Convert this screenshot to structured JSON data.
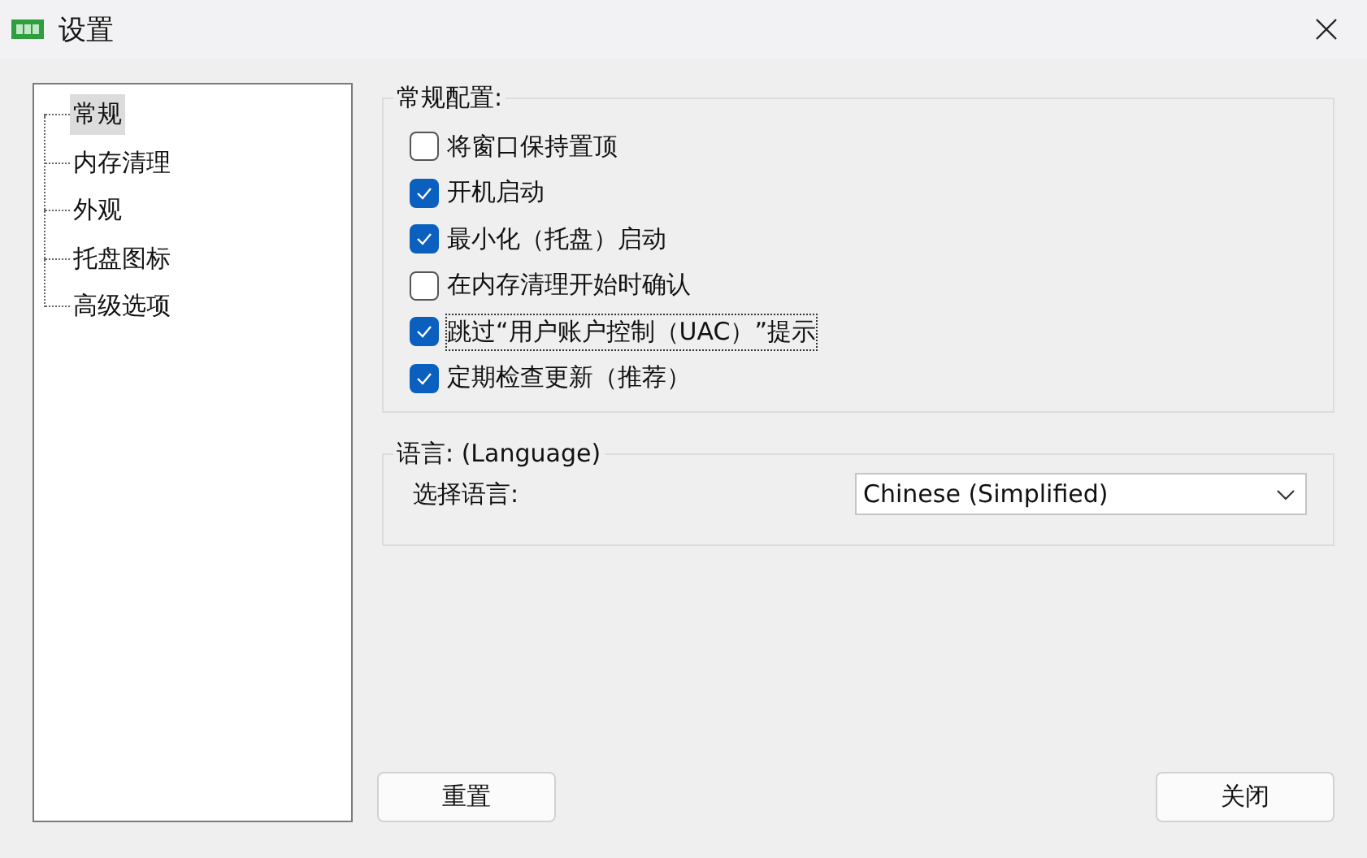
{
  "window": {
    "title": "设置"
  },
  "sidebar": {
    "items": [
      {
        "label": "常规",
        "selected": true
      },
      {
        "label": "内存清理",
        "selected": false
      },
      {
        "label": "外观",
        "selected": false
      },
      {
        "label": "托盘图标",
        "selected": false
      },
      {
        "label": "高级选项",
        "selected": false
      }
    ]
  },
  "general": {
    "title": "常规配置:",
    "options": [
      {
        "label": "将窗口保持置顶",
        "checked": false,
        "focused": false
      },
      {
        "label": "开机启动",
        "checked": true,
        "focused": false
      },
      {
        "label": "最小化（托盘）启动",
        "checked": true,
        "focused": false
      },
      {
        "label": "在内存清理开始时确认",
        "checked": false,
        "focused": false
      },
      {
        "label": "跳过“用户账户控制（UAC）”提示",
        "checked": true,
        "focused": true
      },
      {
        "label": "定期检查更新（推荐）",
        "checked": true,
        "focused": false
      }
    ]
  },
  "language": {
    "title": "语言: (Language)",
    "label": "选择语言:",
    "value": "Chinese (Simplified)"
  },
  "buttons": [
    "重置",
    "关闭"
  ]
}
